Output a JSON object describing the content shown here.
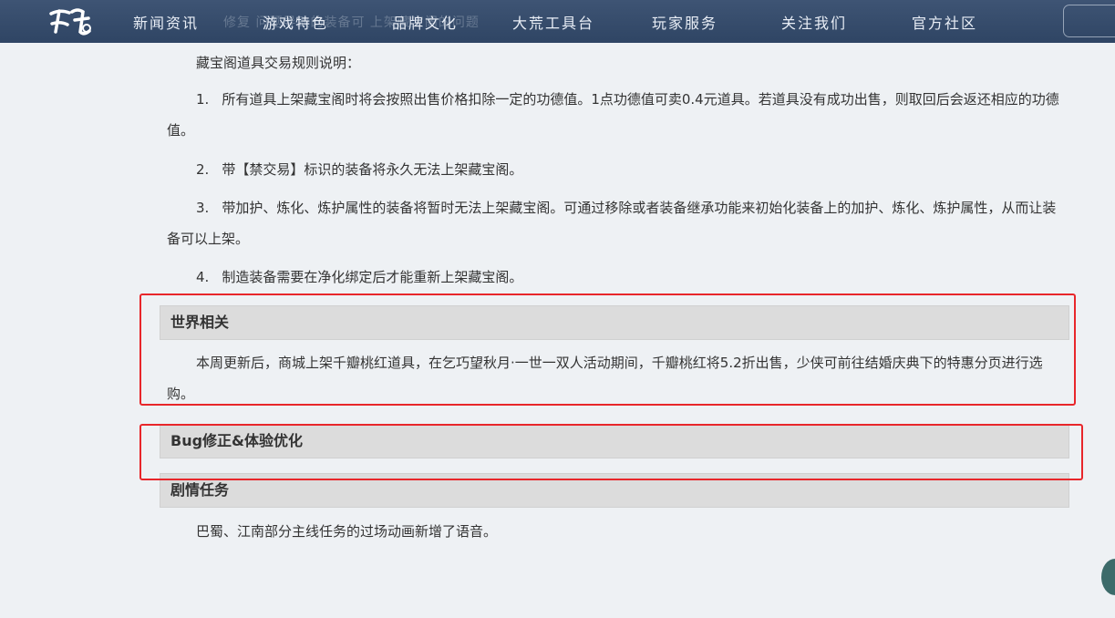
{
  "nav": {
    "logo_text": "天下",
    "background_text": "修复  问题导致的装备可  上架藏宝阁的问题",
    "items": [
      {
        "label": "新闻资讯"
      },
      {
        "label": "游戏特色"
      },
      {
        "label": "品牌文化"
      },
      {
        "label": "大荒工具台"
      },
      {
        "label": "玩家服务"
      },
      {
        "label": "关注我们"
      },
      {
        "label": "官方社区"
      }
    ]
  },
  "article": {
    "intro": "藏宝阁道具交易规则说明：",
    "rules": [
      {
        "num": "1.",
        "text": "所有道具上架藏宝阁时将会按照出售价格扣除一定的功德值。1点功德值可卖0.4元道具。若道具没有成功出售，则取回后会返还相应的功德值。"
      },
      {
        "num": "2.",
        "text": "带【禁交易】标识的装备将永久无法上架藏宝阁。"
      },
      {
        "num": "3.",
        "text": "带加护、炼化、炼护属性的装备将暂时无法上架藏宝阁。可通过移除或者装备继承功能来初始化装备上的加护、炼化、炼护属性，从而让装备可以上架。"
      },
      {
        "num": "4.",
        "text": "制造装备需要在净化绑定后才能重新上架藏宝阁。"
      }
    ],
    "sections": [
      {
        "title": "世界相关",
        "body": "本周更新后，商城上架千瓣桃红道具，在乞巧望秋月·一世一双人活动期间，千瓣桃红将5.2折出售，少侠可前往结婚庆典下的特惠分页进行选购。"
      },
      {
        "title": "Bug修正&体验优化",
        "body": ""
      },
      {
        "title": "剧情任务",
        "body": "巴蜀、江南部分主线任务的过场动画新增了语音。"
      }
    ]
  },
  "annotation_color": "#e8262a"
}
